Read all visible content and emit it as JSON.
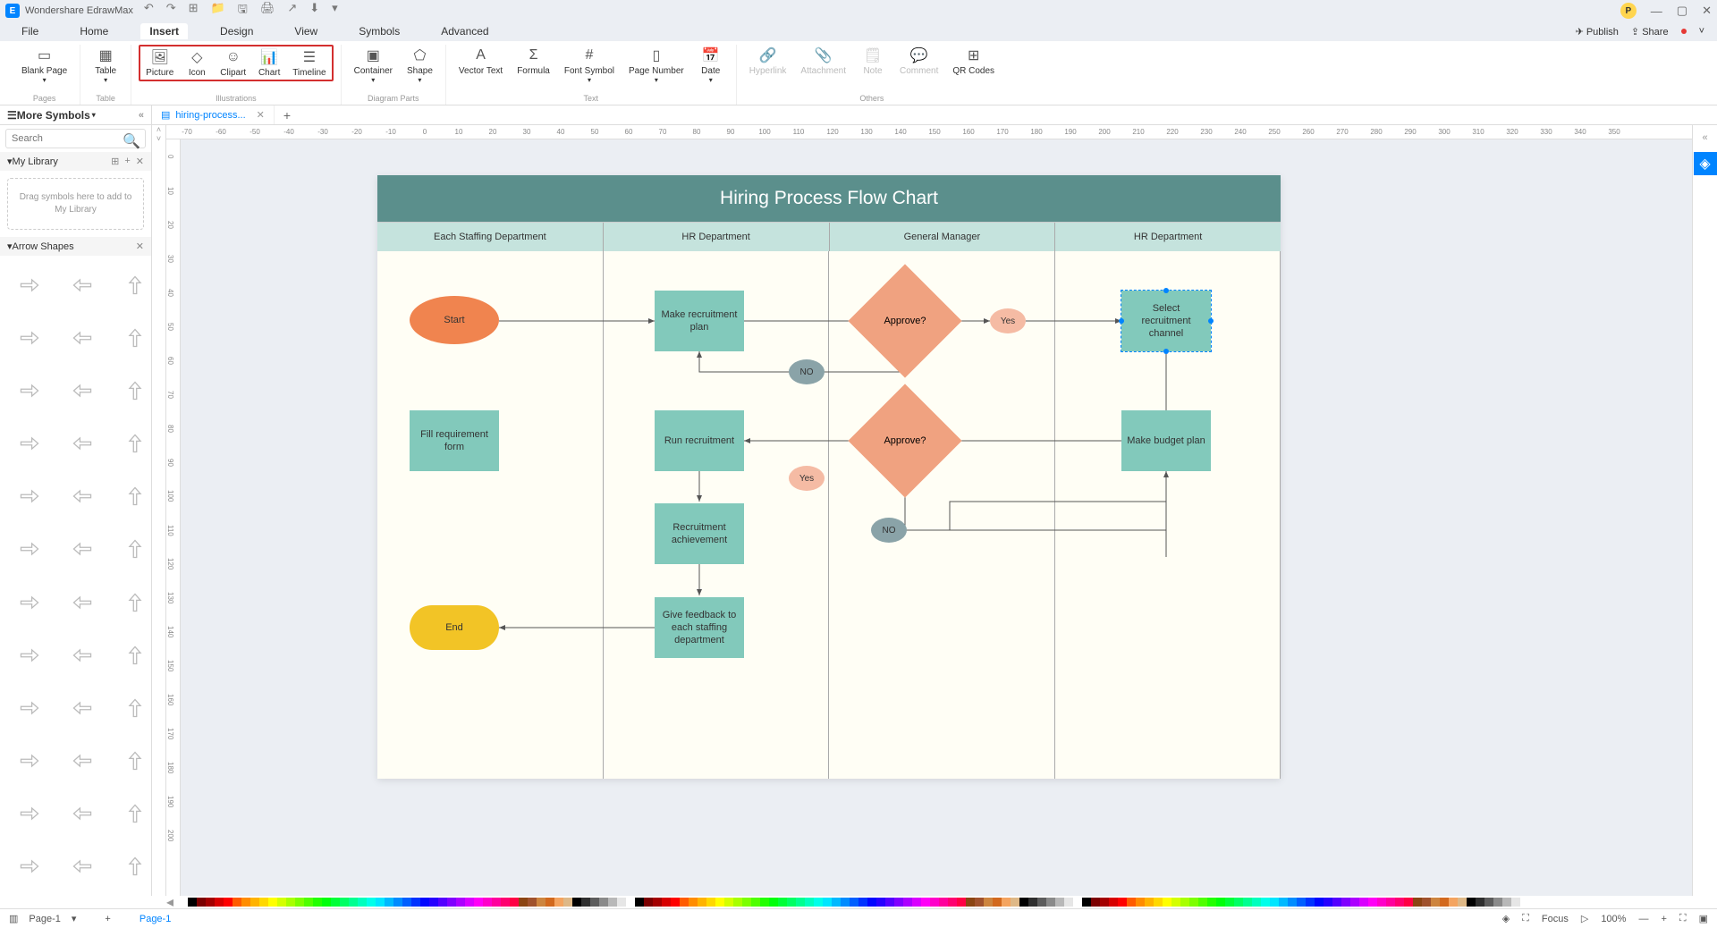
{
  "app": {
    "name": "Wondershare EdrawMax",
    "avatar_letter": "P"
  },
  "qat": [
    "↶",
    "↷",
    "⊞",
    "📁",
    "🖫",
    "🖨",
    "↗",
    "⬇",
    "▾"
  ],
  "window_controls": [
    "—",
    "▢",
    "✕"
  ],
  "menu": {
    "items": [
      "File",
      "Home",
      "Insert",
      "Design",
      "View",
      "Symbols",
      "Advanced"
    ],
    "active": "Insert",
    "publish": "Publish",
    "share": "Share"
  },
  "ribbon": {
    "pages": {
      "label": "Pages",
      "blank": "Blank\nPage"
    },
    "table": {
      "label": "Table",
      "table": "Table"
    },
    "illustrations": {
      "label": "Illustrations",
      "picture": "Picture",
      "icon": "Icon",
      "clipart": "Clipart",
      "chart": "Chart",
      "timeline": "Timeline"
    },
    "diagram_parts": {
      "label": "Diagram Parts",
      "container": "Container",
      "shape": "Shape"
    },
    "text": {
      "label": "Text",
      "vector_text": "Vector\nText",
      "formula": "Formula",
      "font_symbol": "Font\nSymbol",
      "page_number": "Page\nNumber",
      "date": "Date"
    },
    "others": {
      "label": "Others",
      "hyperlink": "Hyperlink",
      "attachment": "Attachment",
      "note": "Note",
      "comment": "Comment",
      "qr": "QR\nCodes"
    }
  },
  "sidebar": {
    "title": "More Symbols",
    "search_placeholder": "Search",
    "my_library": "My Library",
    "my_library_empty": "Drag symbols\nhere to add to\nMy Library",
    "arrow_shapes": "Arrow Shapes"
  },
  "tabs": {
    "doc": "hiring-process..."
  },
  "ruler_h": [
    "-70",
    "-60",
    "-50",
    "-40",
    "-30",
    "-20",
    "-10",
    "0",
    "10",
    "20",
    "30",
    "40",
    "50",
    "60",
    "70",
    "80",
    "90",
    "100",
    "110",
    "120",
    "130",
    "140",
    "150",
    "160",
    "170",
    "180",
    "190",
    "200",
    "210",
    "220",
    "230",
    "240",
    "250",
    "260",
    "270",
    "280",
    "290",
    "300",
    "310",
    "320",
    "330",
    "340",
    "350"
  ],
  "ruler_v": [
    "0",
    "10",
    "20",
    "30",
    "40",
    "50",
    "60",
    "70",
    "80",
    "90",
    "100",
    "110",
    "120",
    "130",
    "140",
    "150",
    "160",
    "170",
    "180",
    "190",
    "200"
  ],
  "chart": {
    "title": "Hiring Process Flow Chart",
    "lanes": [
      "Each Staffing Department",
      "HR Department",
      "General Manager",
      "HR Department"
    ],
    "nodes": {
      "start": "Start",
      "fill_req": "Fill requirement form",
      "make_plan": "Make recruitment plan",
      "approve1": "Approve?",
      "yes1": "Yes",
      "no1": "NO",
      "select_channel": "Select recruitment channel",
      "make_budget": "Make budget plan",
      "approve2": "Approve?",
      "yes2": "Yes",
      "no2": "NO",
      "run_rec": "Run recruitment",
      "achievement": "Recruitment achievement",
      "feedback": "Give feedback to each staffing department",
      "end": "End"
    }
  },
  "status": {
    "page_label": "Page-1",
    "page_tab": "Page-1",
    "focus": "Focus",
    "zoom": "100%"
  },
  "colors": [
    "#ffffff",
    "#000000",
    "#7b0000",
    "#a30000",
    "#d70000",
    "#ff0000",
    "#ff5b00",
    "#ff8c00",
    "#ffb300",
    "#ffd800",
    "#ffff00",
    "#d4ff00",
    "#a8ff00",
    "#7cff00",
    "#4fff00",
    "#22ff00",
    "#00ff0a",
    "#00ff37",
    "#00ff64",
    "#00ff91",
    "#00ffbe",
    "#00ffea",
    "#00e6ff",
    "#00b9ff",
    "#008cff",
    "#005fff",
    "#0033ff",
    "#0006ff",
    "#2600ff",
    "#5300ff",
    "#8000ff",
    "#ac00ff",
    "#d900ff",
    "#ff00f7",
    "#ff00ca",
    "#ff009d",
    "#ff0070",
    "#ff0044",
    "#8b4513",
    "#a0522d",
    "#cd853f",
    "#d2691e",
    "#f4a460",
    "#deb887",
    "#000000",
    "#2e2e2e",
    "#5c5c5c",
    "#8a8a8a",
    "#b8b8b8",
    "#e6e6e6"
  ]
}
